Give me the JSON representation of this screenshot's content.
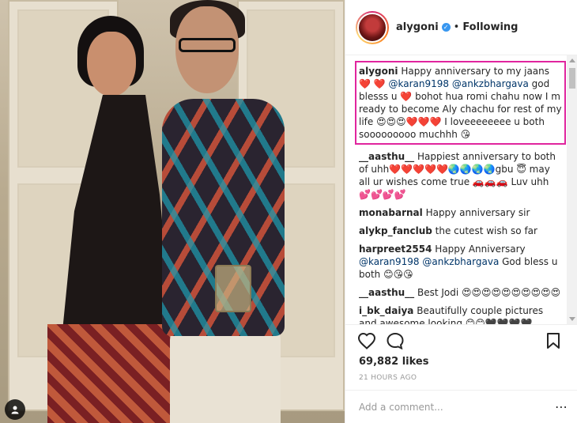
{
  "post": {
    "username": "alygoni",
    "separator": "•",
    "follow_status": "Following",
    "likes": "69,882 likes",
    "timestamp": "21 HOURS AGO",
    "comment_placeholder": "Add a comment...",
    "more_icon": "⋯"
  },
  "icons": {
    "heart": "heart-icon",
    "comment": "comment-icon",
    "bookmark": "bookmark-icon",
    "verified": "verified-badge-icon",
    "tag": "user-tag-icon"
  },
  "colors": {
    "highlight": "#e0259e",
    "mention": "#003569",
    "verified": "#3897f0"
  },
  "caption": {
    "user": "alygoni",
    "t1": " Happy anniversary to my jaans ❤️ ❤️ ",
    "m1": "@karan9198",
    "t2": " ",
    "m2": "@ankzbhargava",
    "t3": " god blesss u ❤️ bohot hua romi chahu now I m ready to become Aly chachu for rest of my life 😍😍😍❤️❤️❤️ I loveeeeeeee u both sooooooooo muchhh 😘"
  },
  "comments": [
    {
      "user": "__aasthu__",
      "text": " Happiest anniversary to both of uhh❤️❤️❤️❤️❤️🌏🌏🌏🌏gbu 😇 may all ur wishes come true 🚗🚗🚗 Luv uhh 💕💕💕💕"
    },
    {
      "user": "monabarnal",
      "text": " Happy anniversary sir"
    },
    {
      "user": "alykp_fanclub",
      "text": " the cutest wish so far"
    },
    {
      "user": "harpreet2554",
      "t1": " Happy Anniversary ",
      "m1": "@karan9198",
      "t2": " ",
      "m2": "@ankzbhargava",
      "t3": " God bless u both 😊😘😘"
    },
    {
      "user": "__aasthu__",
      "text": " Best Jodi 😍😍😍😍😍😍😍😍😍😍"
    },
    {
      "user": "i_bk_daiya",
      "text": " Beautifully couple pictures and awesome looking 😊😊🖤🖤🖤🖤"
    }
  ]
}
